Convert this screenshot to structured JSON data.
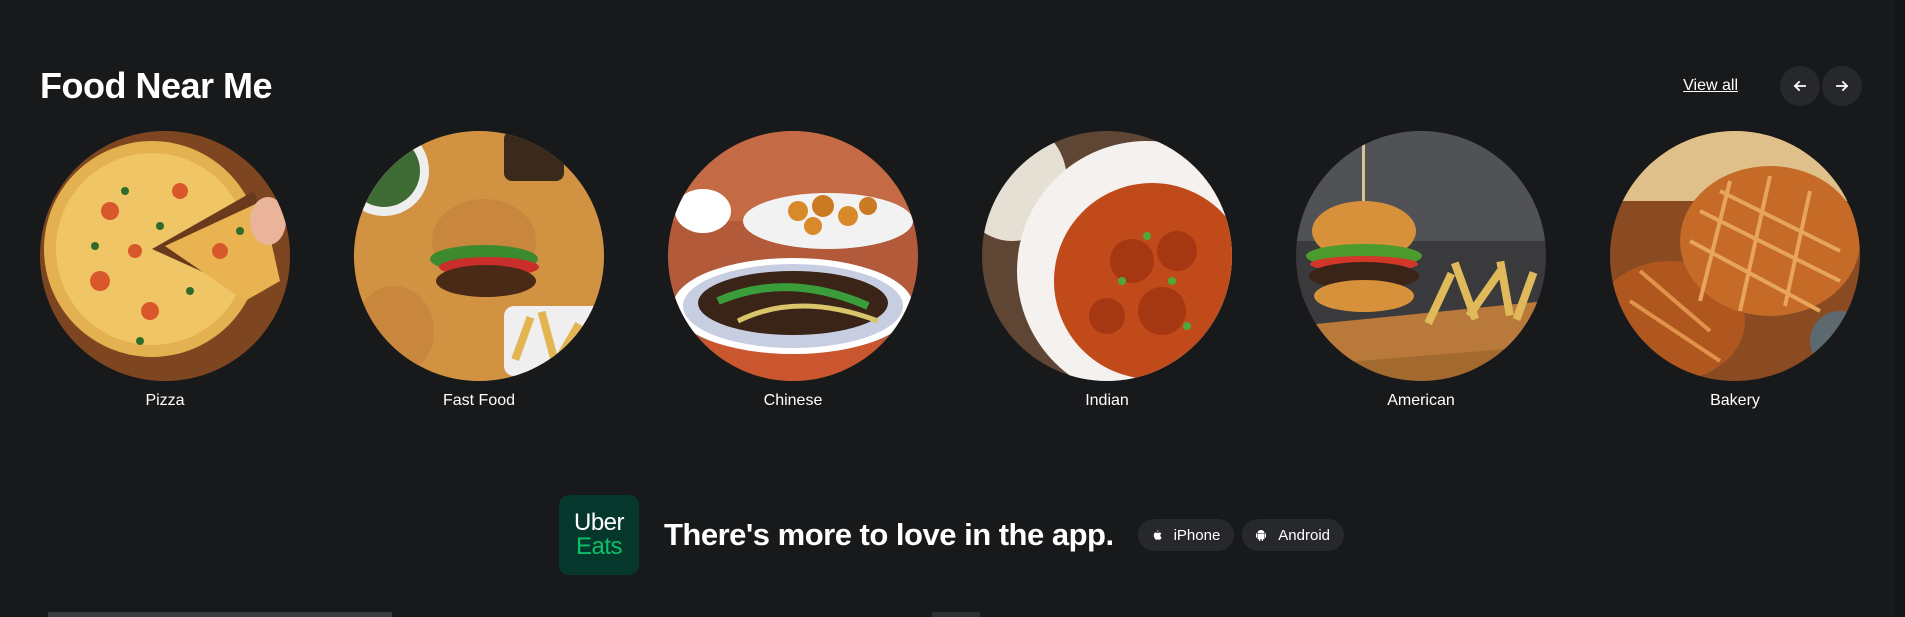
{
  "section": {
    "title": "Food Near Me",
    "view_all": "View all"
  },
  "categories": [
    {
      "label": "Pizza",
      "icon": "pizza-image"
    },
    {
      "label": "Fast Food",
      "icon": "fast-food-image"
    },
    {
      "label": "Chinese",
      "icon": "chinese-food-image"
    },
    {
      "label": "Indian",
      "icon": "indian-food-image"
    },
    {
      "label": "American",
      "icon": "american-food-image"
    },
    {
      "label": "Bakery",
      "icon": "bakery-image"
    }
  ],
  "app_banner": {
    "logo_line1": "Uber",
    "logo_line2": "Eats",
    "text": "There's more to love in the app.",
    "iphone_label": "iPhone",
    "android_label": "Android"
  },
  "colors": {
    "background": "#18191b",
    "button": "#26282b",
    "logo_bg": "#06372d",
    "brand_green": "#06c167"
  }
}
